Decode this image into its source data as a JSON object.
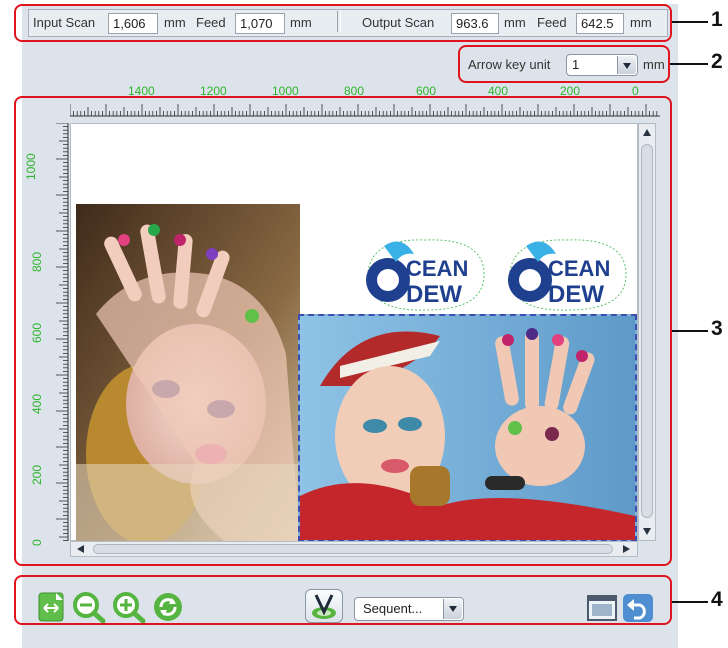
{
  "size_bar": {
    "input_scan_label": "Input Scan",
    "input_scan_value": "1,606",
    "input_scan_unit": "mm",
    "input_feed_label": "Feed",
    "input_feed_value": "1,070",
    "input_feed_unit": "mm",
    "output_scan_label": "Output Scan",
    "output_scan_value": "963.6",
    "output_scan_unit": "mm",
    "output_feed_label": "Feed",
    "output_feed_value": "642.5",
    "output_feed_unit": "mm"
  },
  "arrow_key": {
    "label": "Arrow key unit",
    "value": "1",
    "unit": "mm"
  },
  "top_ruler": {
    "labels": [
      "1400",
      "1200",
      "1000",
      "800",
      "600",
      "400",
      "200",
      "0"
    ]
  },
  "left_ruler": {
    "labels": [
      "1000",
      "800",
      "600",
      "400",
      "200",
      "0"
    ]
  },
  "preview": {
    "logo_text_top": "CEAN",
    "logo_text_bottom": "DEW",
    "logo_initial": "O"
  },
  "toolbar": {
    "layout_select_value": "Sequent..."
  },
  "callouts": [
    "1",
    "2",
    "3",
    "4"
  ],
  "colors": {
    "callout": "#e0141d",
    "ruler_numbers": "#2db52d",
    "panel": "#dde3ea",
    "selection_border": "#3b4fb2"
  }
}
